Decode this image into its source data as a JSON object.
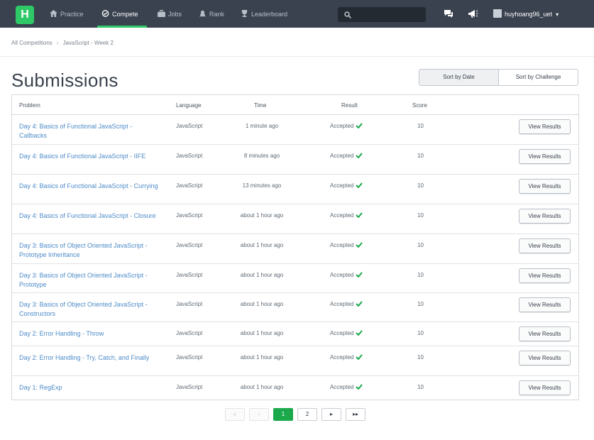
{
  "nav": {
    "logo_letter": "H",
    "items": [
      {
        "label": "Practice",
        "icon": "home-icon"
      },
      {
        "label": "Compete",
        "icon": "trophy-icon"
      },
      {
        "label": "Jobs",
        "icon": "briefcase-icon"
      },
      {
        "label": "Rank",
        "icon": "rank-icon"
      },
      {
        "label": "Leaderboard",
        "icon": "leaderboard-icon"
      }
    ],
    "active": "Compete",
    "search_placeholder": "",
    "username": "huyhoang96_uet"
  },
  "breadcrumb": {
    "root": "All Competitions",
    "current": "JavaScript - Week 2"
  },
  "page_title": "Submissions",
  "sort": {
    "by_date": "Sort by Date",
    "by_challenge": "Sort by Challenge"
  },
  "table": {
    "headers": {
      "problem": "Problem",
      "language": "Language",
      "time": "Time",
      "result": "Result",
      "score": "Score"
    },
    "view_label": "View Results",
    "rows": [
      {
        "problem": "Day 4: Basics of Functional JavaScript - Callbacks",
        "language": "JavaScript",
        "time": "1 minute ago",
        "result": "Accepted",
        "score": "10"
      },
      {
        "problem": "Day 4: Basics of Functional JavaScript - IIFE",
        "language": "JavaScript",
        "time": "8 minutes ago",
        "result": "Accepted",
        "score": "10"
      },
      {
        "problem": "Day 4: Basics of Functional JavaScript - Currying",
        "language": "JavaScript",
        "time": "13 minutes ago",
        "result": "Accepted",
        "score": "10"
      },
      {
        "problem": "Day 4: Basics of Functional JavaScript - Closure",
        "language": "JavaScript",
        "time": "about 1 hour ago",
        "result": "Accepted",
        "score": "10"
      },
      {
        "problem": "Day 3: Basics of Object Oriented JavaScript - Prototype Inheritance",
        "language": "JavaScript",
        "time": "about 1 hour ago",
        "result": "Accepted",
        "score": "10"
      },
      {
        "problem": "Day 3: Basics of Object Oriented JavaScript - Prototype",
        "language": "JavaScript",
        "time": "about 1 hour ago",
        "result": "Accepted",
        "score": "10"
      },
      {
        "problem": "Day 3: Basics of Object Oriented JavaScript - Constructors",
        "language": "JavaScript",
        "time": "about 1 hour ago",
        "result": "Accepted",
        "score": "10"
      },
      {
        "problem": "Day 2: Error Handling - Throw",
        "language": "JavaScript",
        "time": "about 1 hour ago",
        "result": "Accepted",
        "score": "10"
      },
      {
        "problem": "Day 2: Error Handling - Try, Catch, and Finally",
        "language": "JavaScript",
        "time": "about 1 hour ago",
        "result": "Accepted",
        "score": "10"
      },
      {
        "problem": "Day 1: RegExp",
        "language": "JavaScript",
        "time": "about 1 hour ago",
        "result": "Accepted",
        "score": "10"
      }
    ]
  },
  "pagination": {
    "first": "«",
    "prev": "‹",
    "pages": [
      "1",
      "2"
    ],
    "current": "1",
    "next": "▸",
    "last": "▸▸"
  },
  "colors": {
    "nav_bg": "#39424e",
    "brand_green": "#2ec866",
    "link_blue": "#4d8bc8",
    "accepted_check": "#1ba94c"
  }
}
